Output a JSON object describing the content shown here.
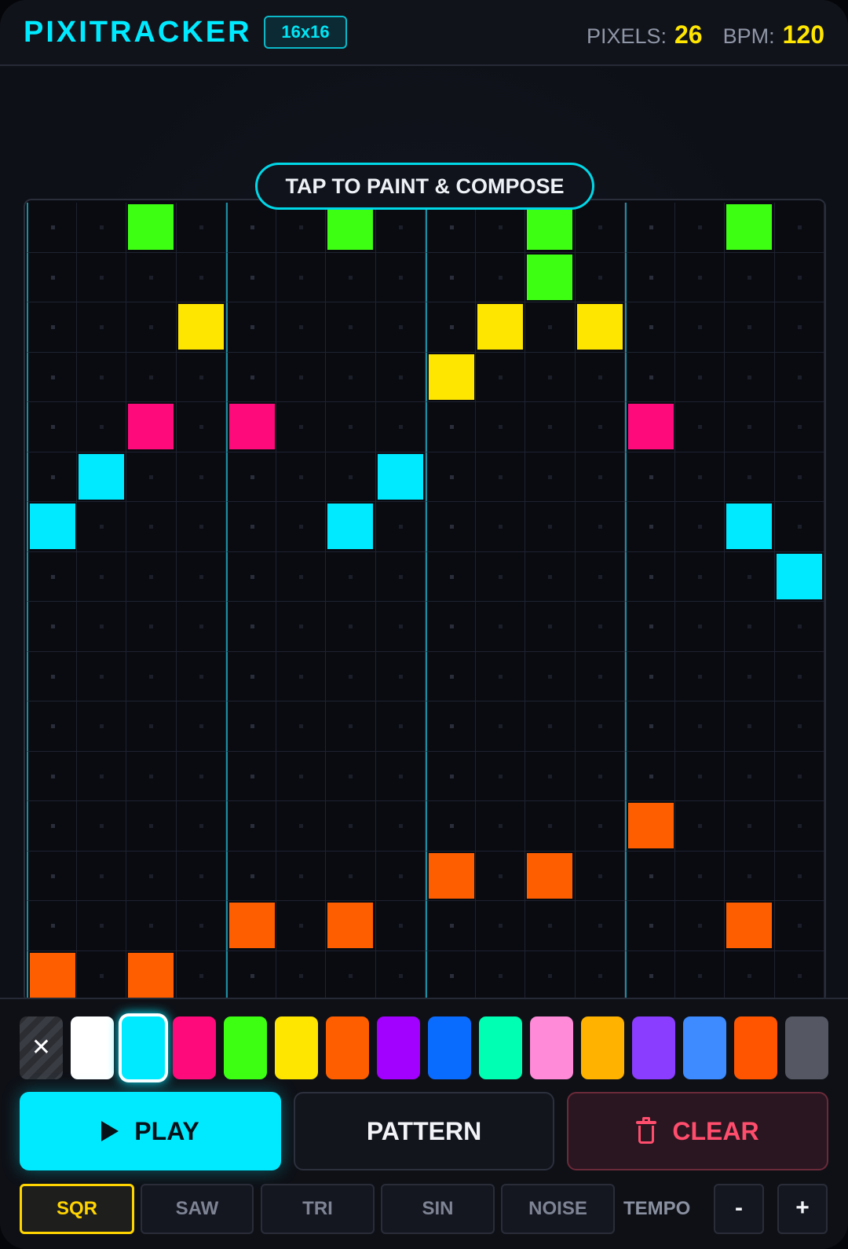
{
  "header": {
    "title": "PIXITRACKER",
    "grid_size": "16x16",
    "pixels_label": "PIXELS:",
    "pixels_value": "26",
    "bpm_label": "BPM:",
    "bpm_value": "120"
  },
  "hint": "TAP TO PAINT & COMPOSE",
  "grid": {
    "columns": 16,
    "rows": 16,
    "cells": [
      {
        "col": 2,
        "row": 0,
        "color": "#3dff12"
      },
      {
        "col": 6,
        "row": 0,
        "color": "#3dff12"
      },
      {
        "col": 10,
        "row": 0,
        "color": "#3dff12"
      },
      {
        "col": 14,
        "row": 0,
        "color": "#3dff12"
      },
      {
        "col": 10,
        "row": 1,
        "color": "#3dff12"
      },
      {
        "col": 3,
        "row": 2,
        "color": "#ffe600"
      },
      {
        "col": 9,
        "row": 2,
        "color": "#ffe600"
      },
      {
        "col": 11,
        "row": 2,
        "color": "#ffe600"
      },
      {
        "col": 8,
        "row": 3,
        "color": "#ffe600"
      },
      {
        "col": 2,
        "row": 4,
        "color": "#ff0a7a"
      },
      {
        "col": 4,
        "row": 4,
        "color": "#ff0a7a"
      },
      {
        "col": 12,
        "row": 4,
        "color": "#ff0a7a"
      },
      {
        "col": 1,
        "row": 5,
        "color": "#00eaff"
      },
      {
        "col": 7,
        "row": 5,
        "color": "#00eaff"
      },
      {
        "col": 0,
        "row": 6,
        "color": "#00eaff"
      },
      {
        "col": 6,
        "row": 6,
        "color": "#00eaff"
      },
      {
        "col": 14,
        "row": 6,
        "color": "#00eaff"
      },
      {
        "col": 15,
        "row": 7,
        "color": "#00eaff"
      },
      {
        "col": 12,
        "row": 12,
        "color": "#ff5e00"
      },
      {
        "col": 8,
        "row": 13,
        "color": "#ff5e00"
      },
      {
        "col": 10,
        "row": 13,
        "color": "#ff5e00"
      },
      {
        "col": 4,
        "row": 14,
        "color": "#ff5e00"
      },
      {
        "col": 6,
        "row": 14,
        "color": "#ff5e00"
      },
      {
        "col": 14,
        "row": 14,
        "color": "#ff5e00"
      },
      {
        "col": 0,
        "row": 15,
        "color": "#ff5e00"
      },
      {
        "col": 2,
        "row": 15,
        "color": "#ff5e00"
      }
    ]
  },
  "palette": {
    "eraser_glyph": "✕",
    "selected_index": 1,
    "colors": [
      "#ffffff",
      "#00eaff",
      "#ff0a7a",
      "#3dff12",
      "#ffe600",
      "#ff5e00",
      "#a200ff",
      "#0a6cff",
      "#00ffb3",
      "#ff8ad8",
      "#ffb300",
      "#8a3cff",
      "#3d8bff",
      "#ff5500",
      "#555863"
    ]
  },
  "controls": {
    "play_label": "PLAY",
    "pattern_label": "PATTERN",
    "clear_label": "CLEAR"
  },
  "waveforms": {
    "active": "SQR",
    "sqr": "SQR",
    "saw": "SAW",
    "tri": "TRI",
    "sin": "SIN",
    "noise": "NOISE"
  },
  "tempo": {
    "label": "TEMPO",
    "minus": "-",
    "plus": "+"
  },
  "colors": {
    "accent": "#00eaff",
    "highlight": "#ffe600",
    "danger": "#ff4d6d"
  }
}
